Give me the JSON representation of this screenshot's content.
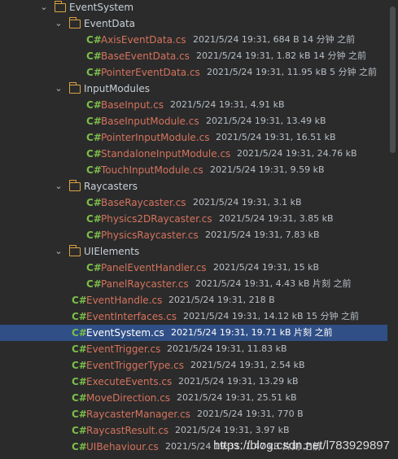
{
  "tree": [
    {
      "kind": "folder",
      "depth": 0,
      "label": "EventSystem",
      "partial": "top"
    },
    {
      "kind": "folder",
      "depth": 1,
      "label": "EventData"
    },
    {
      "kind": "file",
      "depth": 2,
      "label": "AxisEventData.cs",
      "meta": "2021/5/24 19:31, 684 B 14 分钟 之前"
    },
    {
      "kind": "file",
      "depth": 2,
      "label": "BaseEventData.cs",
      "meta": "2021/5/24 19:31, 1.82 kB 14 分钟 之前"
    },
    {
      "kind": "file",
      "depth": 2,
      "label": "PointerEventData.cs",
      "meta": "2021/5/24 19:31, 11.95 kB 5 分钟 之前"
    },
    {
      "kind": "folder",
      "depth": 1,
      "label": "InputModules"
    },
    {
      "kind": "file",
      "depth": 2,
      "label": "BaseInput.cs",
      "meta": "2021/5/24 19:31, 4.91 kB"
    },
    {
      "kind": "file",
      "depth": 2,
      "label": "BaseInputModule.cs",
      "meta": "2021/5/24 19:31, 13.49 kB"
    },
    {
      "kind": "file",
      "depth": 2,
      "label": "PointerInputModule.cs",
      "meta": "2021/5/24 19:31, 16.51 kB"
    },
    {
      "kind": "file",
      "depth": 2,
      "label": "StandaloneInputModule.cs",
      "meta": "2021/5/24 19:31, 24.76 kB"
    },
    {
      "kind": "file",
      "depth": 2,
      "label": "TouchInputModule.cs",
      "meta": "2021/5/24 19:31, 9.59 kB"
    },
    {
      "kind": "folder",
      "depth": 1,
      "label": "Raycasters"
    },
    {
      "kind": "file",
      "depth": 2,
      "label": "BaseRaycaster.cs",
      "meta": "2021/5/24 19:31, 3.1 kB"
    },
    {
      "kind": "file",
      "depth": 2,
      "label": "Physics2DRaycaster.cs",
      "meta": "2021/5/24 19:31, 3.85 kB"
    },
    {
      "kind": "file",
      "depth": 2,
      "label": "PhysicsRaycaster.cs",
      "meta": "2021/5/24 19:31, 7.83 kB"
    },
    {
      "kind": "folder",
      "depth": 1,
      "label": "UIElements"
    },
    {
      "kind": "file",
      "depth": 2,
      "label": "PanelEventHandler.cs",
      "meta": "2021/5/24 19:31, 15 kB"
    },
    {
      "kind": "file",
      "depth": 2,
      "label": "PanelRaycaster.cs",
      "meta": "2021/5/24 19:31, 4.43 kB 片刻 之前"
    },
    {
      "kind": "file",
      "depth": 1,
      "label": "EventHandle.cs",
      "meta": "2021/5/24 19:31, 218 B"
    },
    {
      "kind": "file",
      "depth": 1,
      "label": "EventInterfaces.cs",
      "meta": "2021/5/24 19:31, 14.12 kB 15 分钟 之前"
    },
    {
      "kind": "file",
      "depth": 1,
      "label": "EventSystem.cs",
      "meta": "2021/5/24 19:31, 19.71 kB 片刻 之前",
      "selected": true
    },
    {
      "kind": "file",
      "depth": 1,
      "label": "EventTrigger.cs",
      "meta": "2021/5/24 19:31, 11.83 kB"
    },
    {
      "kind": "file",
      "depth": 1,
      "label": "EventTriggerType.cs",
      "meta": "2021/5/24 19:31, 2.54 kB"
    },
    {
      "kind": "file",
      "depth": 1,
      "label": "ExecuteEvents.cs",
      "meta": "2021/5/24 19:31, 13.29 kB"
    },
    {
      "kind": "file",
      "depth": 1,
      "label": "MoveDirection.cs",
      "meta": "2021/5/24 19:31, 25.51 kB"
    },
    {
      "kind": "file",
      "depth": 1,
      "label": "RaycasterManager.cs",
      "meta": "2021/5/24 19:31, 770 B"
    },
    {
      "kind": "file",
      "depth": 1,
      "label": "RaycastResult.cs",
      "meta": "2021/5/24 19:31, 3.97 kB"
    },
    {
      "kind": "file",
      "depth": 1,
      "label": "UIBehaviour.cs",
      "meta": "2021/5/24 19:31, 1.47 kB 片刻 之前"
    }
  ],
  "icons": {
    "chevron": "chevron-down-icon",
    "folder": "folder-icon",
    "file": "csharp-file-icon",
    "csharp_glyph": "C#"
  },
  "colors": {
    "background": "#2b2b2b",
    "selection": "#2f4f86",
    "file_text": "#d5735d",
    "folder_text": "#c8d0d9",
    "csharp_icon": "#7bbf4a",
    "folder_icon": "#d9a343"
  },
  "watermark": "https://blog.csdn.net/l783929897"
}
